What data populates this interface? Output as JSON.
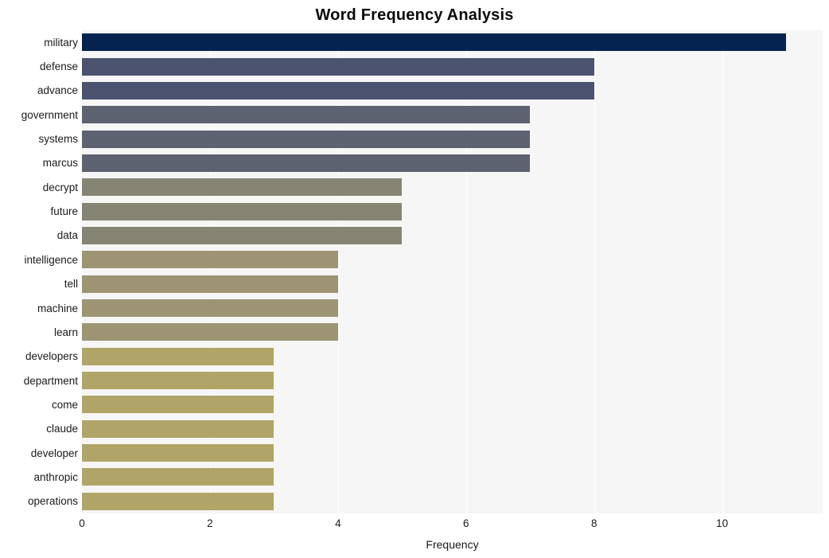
{
  "chart_data": {
    "type": "bar",
    "orientation": "horizontal",
    "title": "Word Frequency Analysis",
    "xlabel": "Frequency",
    "ylabel": "",
    "categories": [
      "military",
      "defense",
      "advance",
      "government",
      "systems",
      "marcus",
      "decrypt",
      "future",
      "data",
      "intelligence",
      "tell",
      "machine",
      "learn",
      "developers",
      "department",
      "come",
      "claude",
      "developer",
      "anthropic",
      "operations"
    ],
    "values": [
      11,
      8,
      8,
      7,
      7,
      7,
      5,
      5,
      5,
      4,
      4,
      4,
      4,
      3,
      3,
      3,
      3,
      3,
      3,
      3
    ],
    "bar_colors": [
      "#04244f",
      "#4b5370",
      "#4b5370",
      "#5d6271",
      "#5d6271",
      "#5d6271",
      "#868573",
      "#868573",
      "#868573",
      "#9d9473",
      "#9d9473",
      "#9d9473",
      "#9d9473",
      "#b0a566",
      "#b0a566",
      "#b0a566",
      "#b0a566",
      "#b0a566",
      "#b0a566",
      "#b0a566"
    ],
    "xlim": [
      0,
      11.57
    ],
    "xticks": [
      0,
      2,
      4,
      6,
      8,
      10
    ],
    "xtick_labels": [
      "0",
      "2",
      "4",
      "6",
      "8",
      "10"
    ],
    "grid": true,
    "grid_axis": "x",
    "grid_color": "#ffffff",
    "plot_background": "#f6f6f7",
    "figure_background": "#ffffff",
    "legend": null
  }
}
